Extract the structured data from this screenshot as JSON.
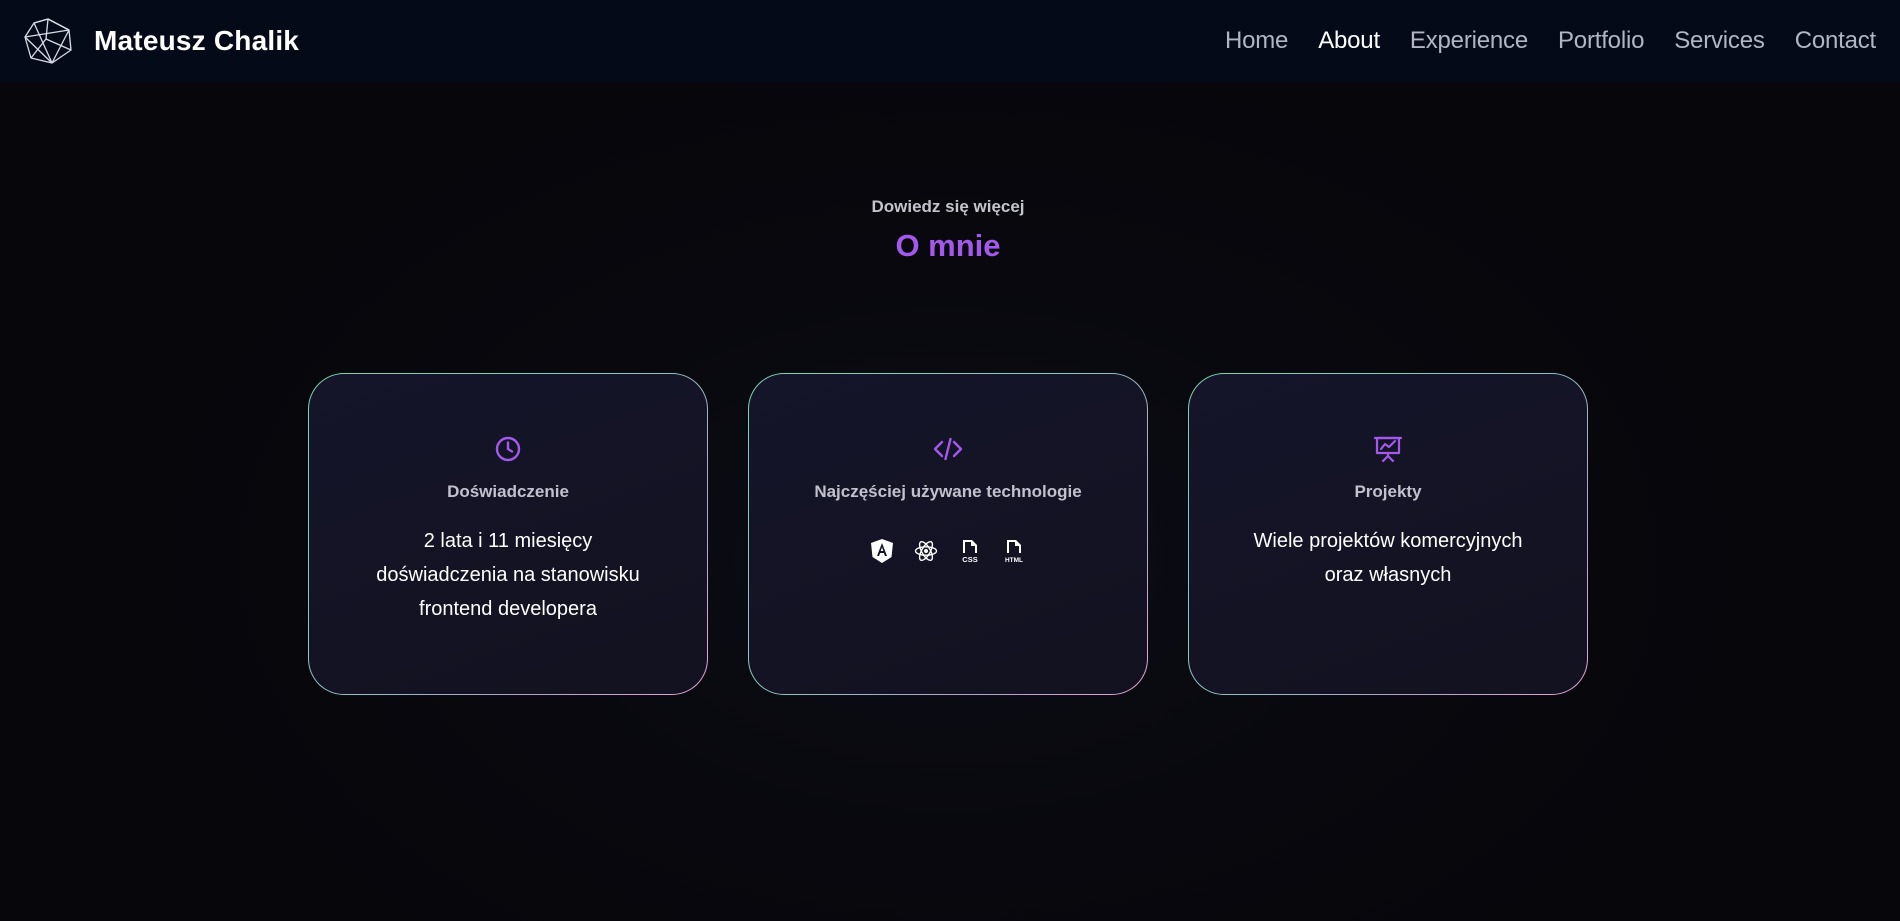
{
  "header": {
    "brand_name": "Mateusz Chalik",
    "logo_icon": "polyhedron-logo-icon",
    "nav": [
      {
        "label": "Home",
        "active": false
      },
      {
        "label": "About",
        "active": true
      },
      {
        "label": "Experience",
        "active": false
      },
      {
        "label": "Portfolio",
        "active": false
      },
      {
        "label": "Services",
        "active": false
      },
      {
        "label": "Contact",
        "active": false
      }
    ]
  },
  "section": {
    "kicker": "Dowiedz się więcej",
    "title": "O mnie"
  },
  "cards": [
    {
      "icon": "clock-icon",
      "title": "Doświadczenie",
      "text": "2 lata i 11 miesięcy doświadczenia na stanowisku frontend developera"
    },
    {
      "icon": "code-icon",
      "title": "Najczęściej używane technologie",
      "technologies": [
        "angular-icon",
        "react-icon",
        "css-file-icon",
        "html-file-icon"
      ]
    },
    {
      "icon": "presentation-chart-icon",
      "title": "Projekty",
      "text": "Wiele projektów komercyjnych oraz własnych"
    }
  ],
  "colors": {
    "accent": "#a259ec",
    "header_bg": "#050a18",
    "page_bg": "#06060b",
    "card_bg": "#14142a",
    "nav_text": "#b2b6c4",
    "nav_active": "#ffffff"
  }
}
